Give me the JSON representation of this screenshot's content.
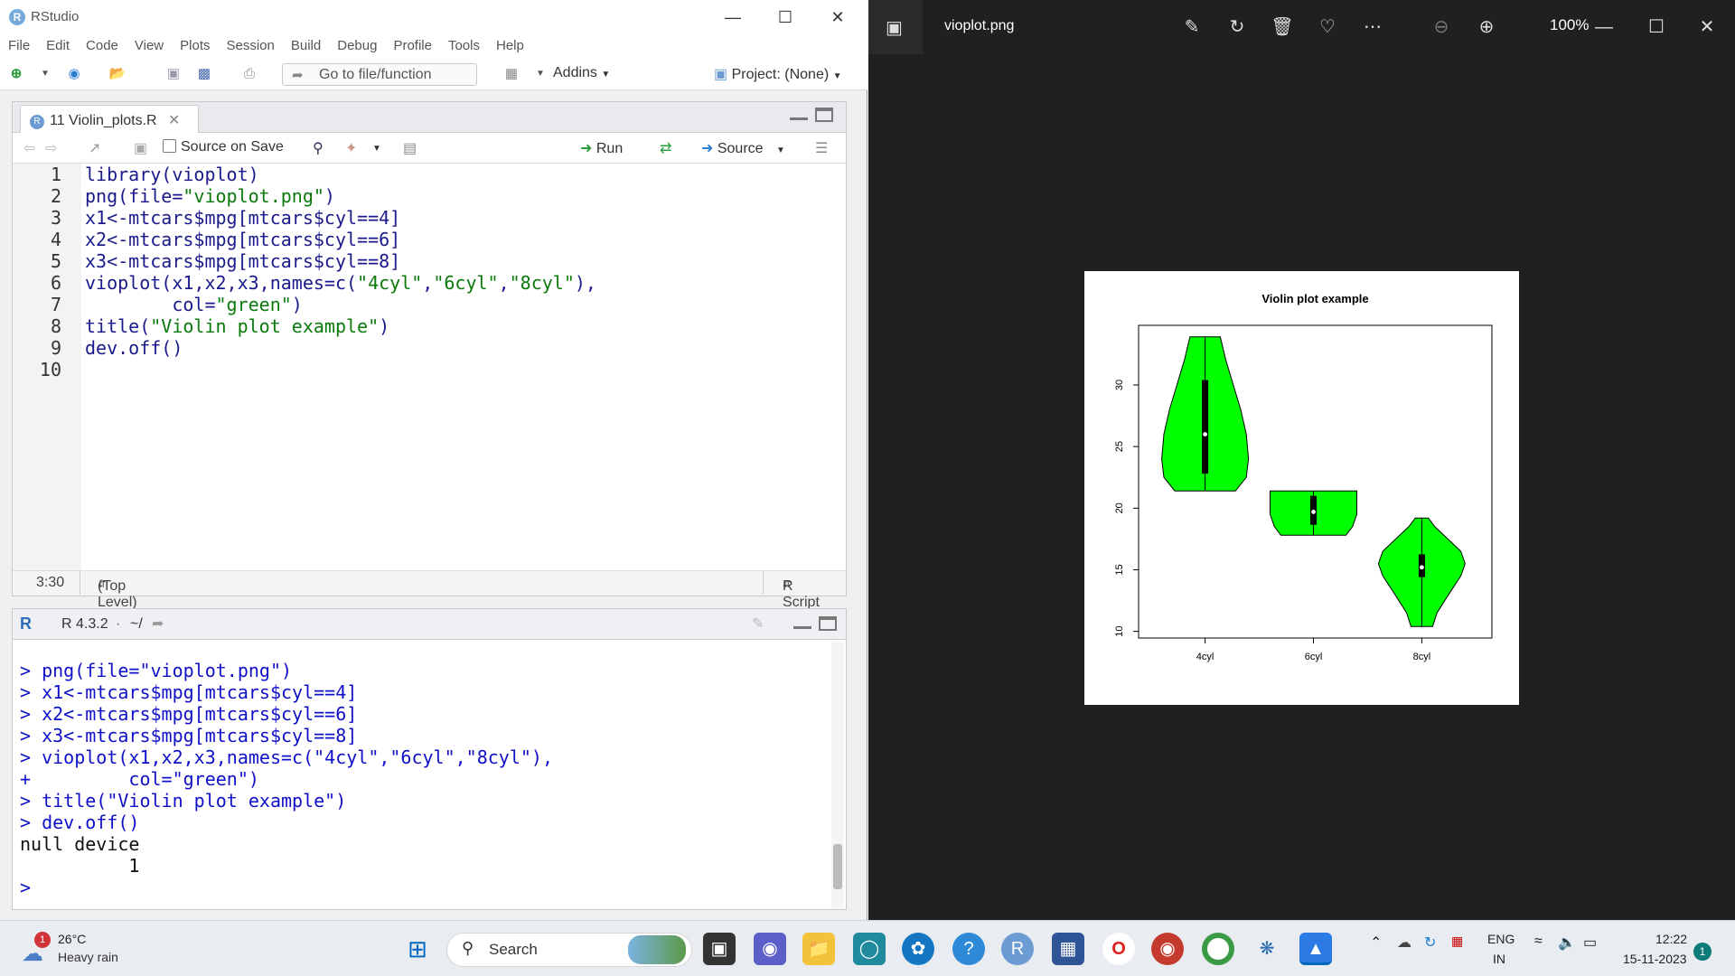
{
  "rstudio": {
    "title": "RStudio",
    "menu": [
      "File",
      "Edit",
      "Code",
      "View",
      "Plots",
      "Session",
      "Build",
      "Debug",
      "Profile",
      "Tools",
      "Help"
    ],
    "goto_placeholder": "Go to file/function",
    "addins": "Addins",
    "project": "Project: (None)",
    "editor": {
      "tab_label": "11 Violin_plots.R",
      "source_on_save": "Source on Save",
      "run": "Run",
      "source": "Source",
      "line_numbers": [
        "1",
        "2",
        "3",
        "4",
        "5",
        "6",
        "7",
        "8",
        "9",
        "10"
      ],
      "lines": [
        "library(vioplot)",
        "png(file=\"vioplot.png\")",
        "x1<-mtcars$mpg[mtcars$cyl==4]",
        "x2<-mtcars$mpg[mtcars$cyl==6]",
        "x3<-mtcars$mpg[mtcars$cyl==8]",
        "vioplot(x1,x2,x3,names=c(\"4cyl\",\"6cyl\",\"8cyl\"),",
        "        col=\"green\")",
        "title(\"Violin plot example\")",
        "dev.off()",
        ""
      ],
      "cursor_pos": "3:30",
      "scope": "(Top Level)",
      "file_type": "R Script"
    },
    "console": {
      "version": "R 4.3.2",
      "path": "~/",
      "lines": [
        {
          "text": "> png(file=\"vioplot.png\")",
          "kind": "cmd"
        },
        {
          "text": "> x1<-mtcars$mpg[mtcars$cyl==4]",
          "kind": "cmd"
        },
        {
          "text": "> x2<-mtcars$mpg[mtcars$cyl==6]",
          "kind": "cmd"
        },
        {
          "text": "> x3<-mtcars$mpg[mtcars$cyl==8]",
          "kind": "cmd"
        },
        {
          "text": "> vioplot(x1,x2,x3,names=c(\"4cyl\",\"6cyl\",\"8cyl\"),",
          "kind": "cmd"
        },
        {
          "text": "+         col=\"green\")",
          "kind": "cmd"
        },
        {
          "text": "> title(\"Violin plot example\")",
          "kind": "cmd"
        },
        {
          "text": "> dev.off()",
          "kind": "cmd"
        },
        {
          "text": "null device",
          "kind": "out"
        },
        {
          "text": "          1",
          "kind": "out"
        },
        {
          "text": "> ",
          "kind": "cmd"
        }
      ]
    }
  },
  "viewer": {
    "file_name": "vioplot.png",
    "zoom": "100%"
  },
  "chart_data": {
    "type": "violin",
    "title": "Violin plot example",
    "categories": [
      "4cyl",
      "6cyl",
      "8cyl"
    ],
    "yticks": [
      10,
      15,
      20,
      25,
      30
    ],
    "ylim": [
      10.4,
      33.9
    ],
    "fill_color": "#00ff00",
    "groups": [
      {
        "name": "4cyl",
        "min": 21.4,
        "q1": 22.8,
        "median": 26.0,
        "q3": 30.4,
        "max": 33.9,
        "profile": [
          [
            21.4,
            0.7
          ],
          [
            22.5,
            0.95
          ],
          [
            24,
            1.0
          ],
          [
            26,
            0.95
          ],
          [
            28,
            0.82
          ],
          [
            30,
            0.65
          ],
          [
            32,
            0.48
          ],
          [
            33.9,
            0.35
          ]
        ]
      },
      {
        "name": "6cyl",
        "min": 17.8,
        "q1": 18.65,
        "median": 19.7,
        "q3": 21.0,
        "max": 21.4,
        "profile": [
          [
            17.8,
            0.75
          ],
          [
            18.5,
            0.9
          ],
          [
            19.5,
            1.0
          ],
          [
            20.5,
            1.0
          ],
          [
            21.4,
            1.0
          ]
        ]
      },
      {
        "name": "8cyl",
        "min": 10.4,
        "q1": 14.4,
        "median": 15.2,
        "q3": 16.25,
        "max": 19.2,
        "profile": [
          [
            10.4,
            0.25
          ],
          [
            11.5,
            0.35
          ],
          [
            13,
            0.62
          ],
          [
            14.5,
            0.9
          ],
          [
            15.5,
            1.0
          ],
          [
            16.5,
            0.9
          ],
          [
            17.5,
            0.6
          ],
          [
            18.5,
            0.3
          ],
          [
            19.2,
            0.15
          ]
        ]
      }
    ]
  },
  "taskbar": {
    "weather_temp": "26°C",
    "weather_desc": "Heavy rain",
    "weather_badge": "1",
    "search": "Search",
    "lang_top": "ENG",
    "lang_bottom": "IN",
    "time": "12:22",
    "date": "15-11-2023",
    "notif_count": "1"
  }
}
